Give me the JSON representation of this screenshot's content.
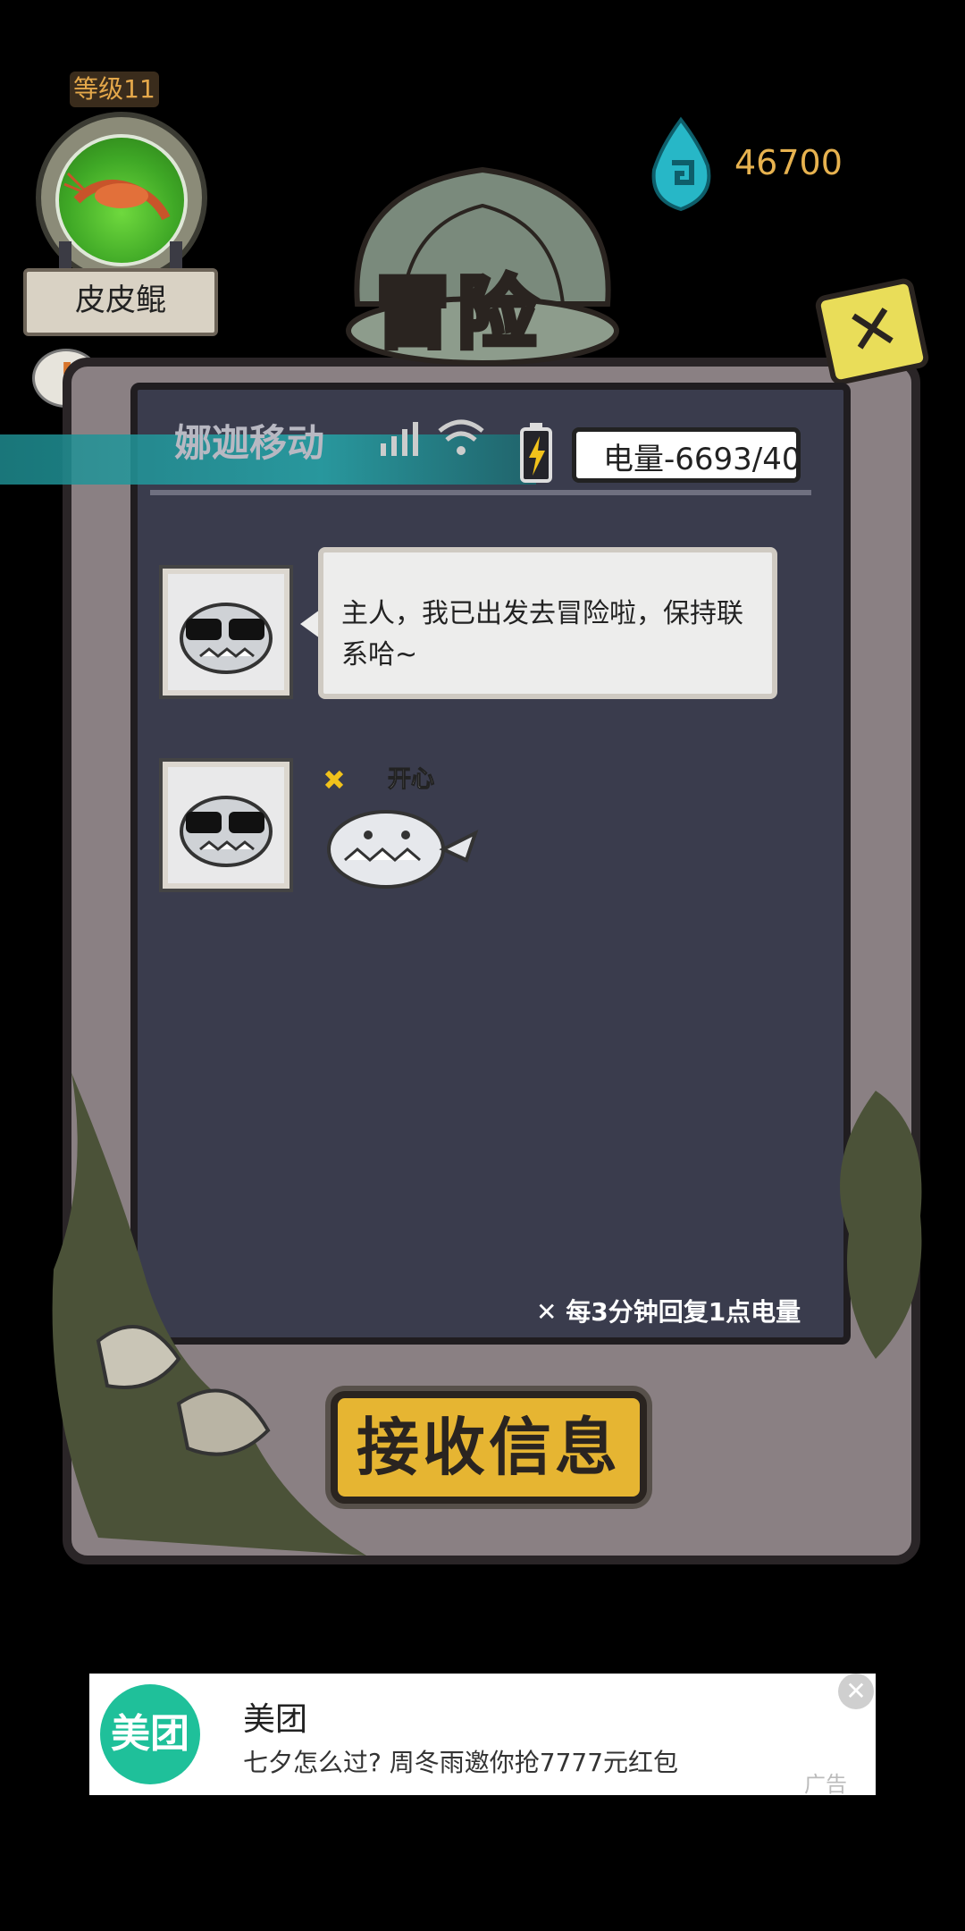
{
  "player": {
    "level": "等级11",
    "name": "皮皮鲲"
  },
  "currency": {
    "icon": "gem-icon",
    "value": "46700"
  },
  "title": "冒险",
  "status_bar": {
    "carrier": "娜迦移动",
    "energy": "电量-6693/40"
  },
  "messages": [
    {
      "type": "text",
      "text": "主人，我已出发去冒险啦，保持联系哈~"
    },
    {
      "type": "sticker",
      "caption": "开心"
    }
  ],
  "regen_note": "每3分钟回复1点电量",
  "receive_button": "接收信息",
  "ad": {
    "logo": "美团",
    "title": "美团",
    "description": "七夕怎么过? 周冬雨邀你抢7777元红包",
    "tag": "广告",
    "close": "✕"
  },
  "colors": {
    "accent_gold": "#e7b24f",
    "screen_bg": "#3a3c4d",
    "frame": "#8a8083",
    "button": "#e6b532",
    "ad_logo": "#1fc09a"
  }
}
